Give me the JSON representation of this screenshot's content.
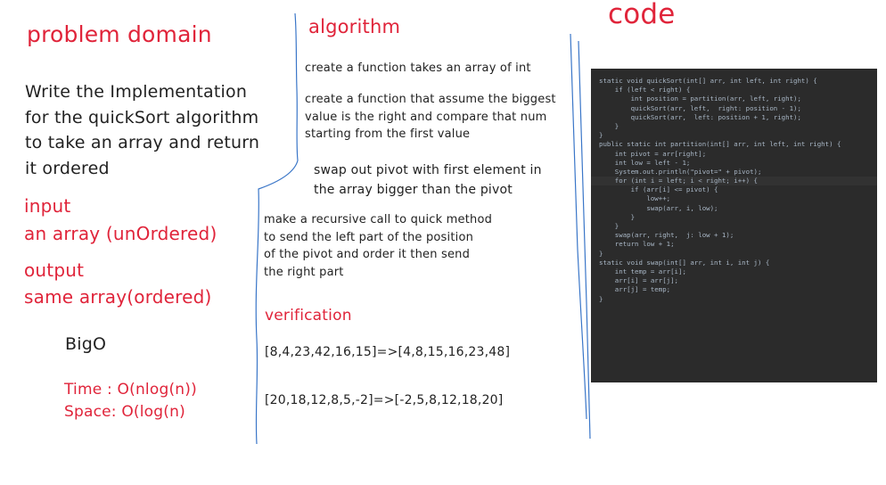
{
  "problem_domain": {
    "heading": "problem domain",
    "description_lines": [
      "Write the Implementation",
      "for the quickSort algorithm",
      "to take an array and return",
      "it ordered"
    ]
  },
  "input": {
    "heading": "input",
    "text": "an array (unOrdered)"
  },
  "output": {
    "heading": "output",
    "text": "same array(ordered)"
  },
  "bigo": {
    "heading": "BigO",
    "time": "Time : O(nlog(n))",
    "space": "Space: O(log(n)"
  },
  "algorithm": {
    "heading": "algorithm",
    "step1": [
      "create a function takes an array of int"
    ],
    "step2": [
      "create a function that assume the biggest",
      "value is the right and compare that num",
      "starting from the first value"
    ],
    "step3": [
      "swap out pivot with first element in",
      "the array bigger than the pivot"
    ],
    "step4": [
      "make a recursive call to quick method",
      "to send the left part of the position",
      "of the pivot and order it then send",
      "the right part"
    ]
  },
  "verification": {
    "heading": "verification",
    "examples": [
      "[8,4,23,42,16,15]=>[4,8,15,16,23,48]",
      "[20,18,12,8,5,-2]=>[-2,5,8,12,18,20]"
    ]
  },
  "code": {
    "heading": "code",
    "lines": [
      "static void quickSort(int[] arr, int left, int right) {",
      "    if (left < right) {",
      "        int position = partition(arr, left, right);",
      "        quickSort(arr, left,  right: position - 1);",
      "        quickSort(arr,  left: position + 1, right);",
      "    }",
      "}",
      "public static int partition(int[] arr, int left, int right) {",
      "    int pivot = arr[right];",
      "    int low = left - 1;",
      "    System.out.println(\"pivot=\" + pivot);",
      "    for (int i = left; i < right; i++) {",
      "        if (arr[i] <= pivot) {",
      "            low++;",
      "            swap(arr, i, low);",
      "        }",
      "    }",
      "    swap(arr, right,  j: low + 1);",
      "    return low + 1;",
      "}",
      "static void swap(int[] arr, int i, int j) {",
      "    int temp = arr[i];",
      "    arr[i] = arr[j];",
      "    arr[j] = temp;",
      "}"
    ]
  }
}
